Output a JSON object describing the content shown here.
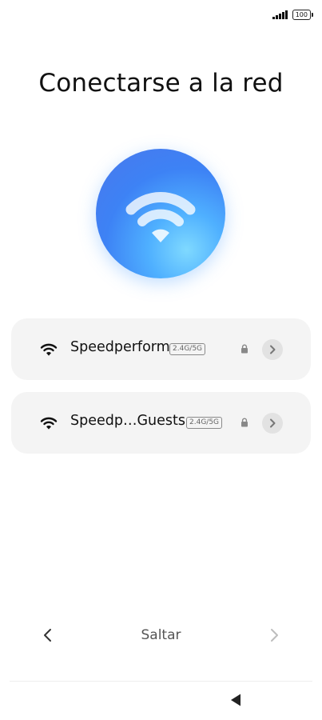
{
  "status_bar": {
    "battery_level": "100",
    "signal_icon": "cell-signal-icon",
    "battery_icon": "battery-icon"
  },
  "page_title": "Conectarse a la red",
  "hero": {
    "icon": "wifi-icon",
    "colors": {
      "start": "#4a78ec",
      "end": "#7fd9ff"
    }
  },
  "networks": [
    {
      "name": "Speedperform",
      "band": "2.4G/5G",
      "secured": true,
      "icon": "wifi-full-icon"
    },
    {
      "name": "Speedp…Guests",
      "band": "2.4G/5G",
      "secured": true,
      "icon": "wifi-full-icon"
    }
  ],
  "footer": {
    "back_icon": "chevron-left-icon",
    "skip_label": "Saltar",
    "next_icon": "chevron-right-icon"
  },
  "system_nav": {
    "back_icon": "triangle-back-icon"
  }
}
